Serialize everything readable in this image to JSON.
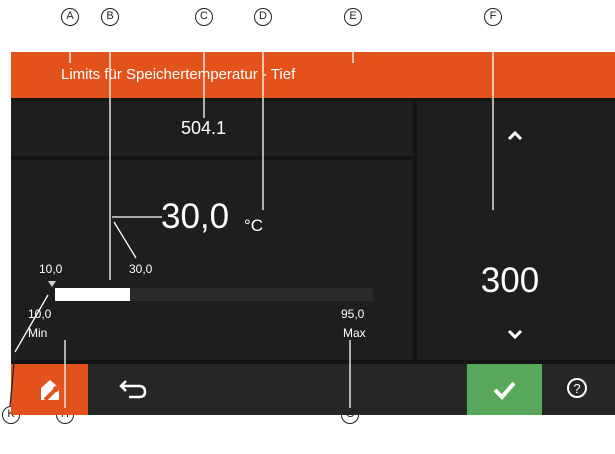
{
  "callouts": {
    "a": "A",
    "b": "B",
    "c": "C",
    "d": "D",
    "e": "E",
    "f": "F",
    "g": "G",
    "h": "H",
    "k": "K"
  },
  "header": {
    "title": "Limits für Speichertemperatur - Tief"
  },
  "top_panel": {
    "value": "504.1"
  },
  "main_panel": {
    "temperature": "30,0",
    "unit": "°C",
    "marker_label": "10,0",
    "fill_label": "30,0",
    "min_value": "10,0",
    "min_label": "Min",
    "max_value": "95,0",
    "max_label": "Max",
    "range_min": 10,
    "range_max": 95,
    "bar_value": 30
  },
  "right_panel": {
    "value": "300"
  },
  "icons": {
    "up": "chevron-up-icon",
    "down": "chevron-down-icon",
    "home": "home-wrench-icon",
    "back": "back-arrow-icon",
    "ok": "checkmark-icon",
    "help": "help-icon"
  },
  "colors": {
    "accent": "#e4521c",
    "ok": "#57a85a",
    "background": "#141414"
  }
}
